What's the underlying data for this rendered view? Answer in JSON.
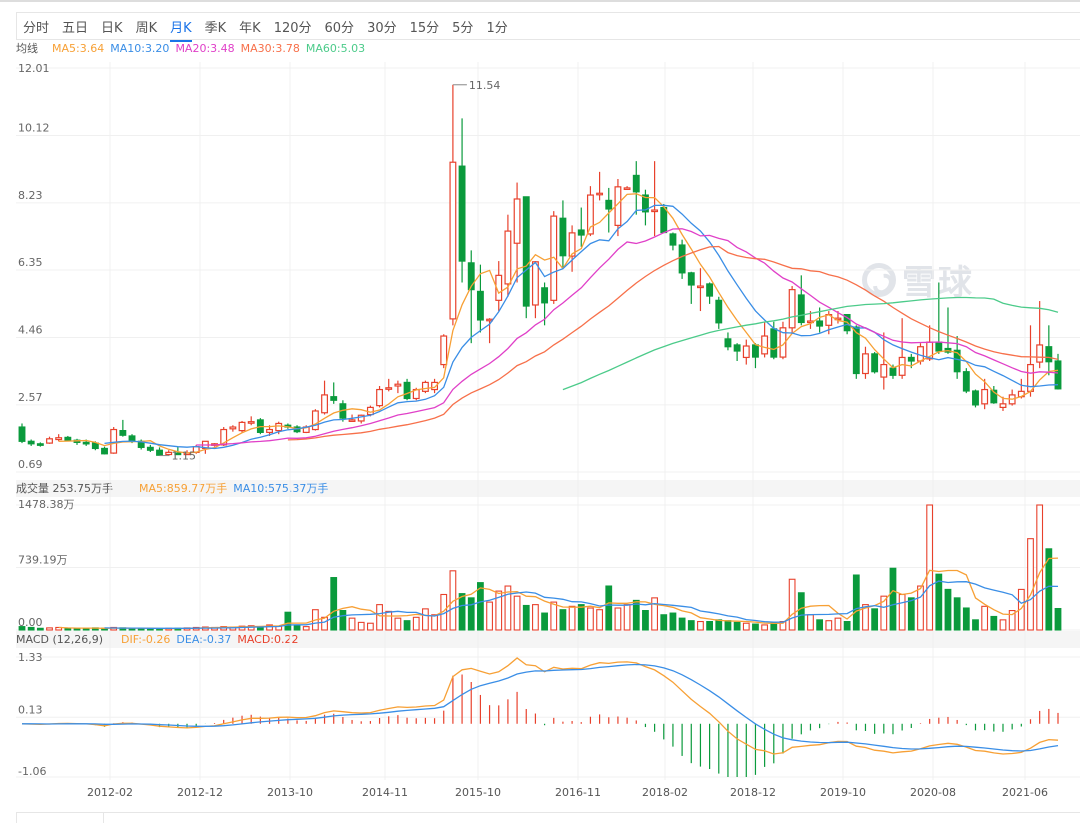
{
  "tabs": [
    "分时",
    "五日",
    "日K",
    "周K",
    "月K",
    "季K",
    "年K",
    "120分",
    "60分",
    "30分",
    "15分",
    "5分",
    "1分"
  ],
  "active_tab": "月K",
  "ma_legend": {
    "label": "均线",
    "items": [
      {
        "text": "MA5:3.64",
        "color": "#f7a035"
      },
      {
        "text": "MA10:3.20",
        "color": "#3a8ee6"
      },
      {
        "text": "MA20:3.48",
        "color": "#e040c8"
      },
      {
        "text": "MA30:3.78",
        "color": "#f7704a"
      },
      {
        "text": "MA60:5.03",
        "color": "#4ccb8a"
      }
    ]
  },
  "volume_legend": {
    "label": "成交量 253.75万手",
    "items": [
      {
        "text": "MA5:859.77万手",
        "color": "#f7a035"
      },
      {
        "text": "MA10:575.37万手",
        "color": "#3a8ee6"
      }
    ]
  },
  "macd_legend": {
    "label": "MACD (12,26,9)",
    "items": [
      {
        "text": "DIF:-0.26",
        "color": "#f7a035"
      },
      {
        "text": "DEA:-0.37",
        "color": "#3a8ee6"
      },
      {
        "text": "MACD:0.22",
        "color": "#e8412c"
      }
    ]
  },
  "watermark": "雪球",
  "colors": {
    "up": "#e8412c",
    "down": "#0a9a3c",
    "grid": "#f0f0f0"
  },
  "chart_data": {
    "type": "candlestick",
    "interval": "monthly",
    "x_labels": [
      "2012-02",
      "2012-12",
      "2013-10",
      "2014-11",
      "2015-10",
      "2016-11",
      "2018-02",
      "2018-12",
      "2019-10",
      "2020-08",
      "2021-06"
    ],
    "price_ticks": [
      "12.01",
      "10.12",
      "8.23",
      "6.35",
      "4.46",
      "2.57",
      "0.69"
    ],
    "price_range": [
      0.69,
      12.01
    ],
    "max_label": "11.54",
    "min_label": "1.15",
    "ma_periods": [
      5,
      10,
      20,
      30,
      60
    ],
    "ohlc": [
      [
        1.95,
        2.05,
        1.5,
        1.55
      ],
      [
        1.55,
        1.6,
        1.42,
        1.48
      ],
      [
        1.48,
        1.52,
        1.4,
        1.45
      ],
      [
        1.5,
        1.68,
        1.48,
        1.62
      ],
      [
        1.6,
        1.75,
        1.55,
        1.65
      ],
      [
        1.66,
        1.7,
        1.55,
        1.58
      ],
      [
        1.58,
        1.62,
        1.45,
        1.52
      ],
      [
        1.52,
        1.6,
        1.42,
        1.5
      ],
      [
        1.5,
        1.55,
        1.3,
        1.35
      ],
      [
        1.35,
        1.4,
        1.18,
        1.2
      ],
      [
        1.22,
        1.95,
        1.2,
        1.88
      ],
      [
        1.85,
        2.15,
        1.68,
        1.72
      ],
      [
        1.7,
        1.75,
        1.5,
        1.55
      ],
      [
        1.55,
        1.6,
        1.32,
        1.38
      ],
      [
        1.38,
        1.45,
        1.25,
        1.3
      ],
      [
        1.3,
        1.38,
        1.15,
        1.16
      ],
      [
        1.18,
        1.3,
        1.16,
        1.24
      ],
      [
        1.22,
        1.4,
        1.18,
        1.2
      ],
      [
        1.2,
        1.3,
        1.17,
        1.22
      ],
      [
        1.24,
        1.45,
        1.2,
        1.4
      ],
      [
        1.35,
        1.5,
        1.2,
        1.55
      ],
      [
        1.45,
        1.5,
        1.4,
        1.48
      ],
      [
        1.45,
        1.95,
        1.42,
        1.88
      ],
      [
        1.9,
        2.0,
        1.82,
        1.95
      ],
      [
        1.85,
        2.12,
        1.8,
        2.08
      ],
      [
        2.1,
        2.25,
        2.0,
        2.1
      ],
      [
        2.15,
        2.2,
        1.75,
        1.8
      ],
      [
        1.8,
        2.0,
        1.7,
        1.88
      ],
      [
        1.85,
        2.1,
        1.75,
        2.05
      ],
      [
        2.0,
        2.05,
        1.9,
        1.95
      ],
      [
        1.95,
        2.0,
        1.78,
        1.82
      ],
      [
        1.8,
        2.0,
        1.78,
        1.95
      ],
      [
        1.88,
        2.45,
        1.85,
        2.4
      ],
      [
        2.35,
        3.25,
        2.3,
        2.85
      ],
      [
        2.8,
        3.2,
        2.6,
        2.7
      ],
      [
        2.6,
        2.7,
        2.1,
        2.2
      ],
      [
        2.15,
        2.3,
        2.1,
        2.15
      ],
      [
        2.12,
        2.3,
        2.05,
        2.28
      ],
      [
        2.3,
        2.55,
        2.25,
        2.5
      ],
      [
        2.55,
        3.1,
        2.5,
        3.0
      ],
      [
        3.05,
        3.3,
        2.95,
        3.05
      ],
      [
        3.1,
        3.25,
        2.9,
        3.15
      ],
      [
        3.2,
        3.3,
        2.7,
        2.75
      ],
      [
        2.75,
        3.05,
        2.7,
        3.0
      ],
      [
        2.95,
        3.25,
        2.9,
        3.2
      ],
      [
        3.0,
        3.3,
        2.9,
        3.2
      ],
      [
        3.7,
        4.55,
        3.6,
        4.5
      ],
      [
        4.98,
        11.54,
        4.8,
        9.37
      ],
      [
        9.26,
        10.6,
        6.0,
        6.6
      ],
      [
        6.55,
        6.9,
        4.3,
        5.8
      ],
      [
        5.75,
        6.5,
        4.6,
        4.95
      ],
      [
        4.97,
        5.0,
        4.3,
        4.97
      ],
      [
        5.5,
        6.6,
        5.2,
        6.2
      ],
      [
        5.96,
        7.9,
        5.6,
        7.44
      ],
      [
        7.1,
        8.8,
        6.0,
        8.34
      ],
      [
        8.4,
        8.4,
        5.0,
        5.34
      ],
      [
        5.37,
        6.6,
        5.0,
        6.58
      ],
      [
        5.85,
        6.0,
        4.8,
        5.43
      ],
      [
        5.5,
        8.0,
        5.4,
        7.86
      ],
      [
        7.8,
        8.3,
        6.4,
        6.75
      ],
      [
        6.74,
        7.6,
        6.3,
        7.39
      ],
      [
        7.47,
        8.1,
        7.0,
        7.33
      ],
      [
        7.36,
        8.7,
        7.3,
        8.45
      ],
      [
        8.5,
        9.1,
        8.3,
        8.5
      ],
      [
        8.3,
        8.65,
        7.4,
        8.06
      ],
      [
        7.6,
        8.9,
        7.3,
        8.68
      ],
      [
        8.65,
        8.7,
        8.6,
        8.65
      ],
      [
        9.0,
        9.4,
        7.9,
        8.54
      ],
      [
        8.45,
        8.6,
        7.6,
        7.98
      ],
      [
        8.03,
        9.4,
        7.3,
        8.03
      ],
      [
        8.1,
        8.2,
        7.4,
        7.4
      ],
      [
        7.36,
        7.4,
        6.9,
        7.05
      ],
      [
        7.05,
        7.2,
        6.1,
        6.27
      ],
      [
        6.27,
        6.3,
        5.4,
        5.93
      ],
      [
        5.9,
        6.4,
        5.2,
        5.9
      ],
      [
        5.96,
        6.0,
        5.4,
        5.62
      ],
      [
        5.5,
        5.6,
        4.7,
        4.87
      ],
      [
        4.42,
        4.6,
        4.1,
        4.2
      ],
      [
        4.25,
        4.3,
        3.8,
        4.08
      ],
      [
        3.9,
        4.4,
        3.7,
        4.22
      ],
      [
        4.25,
        4.3,
        3.6,
        3.91
      ],
      [
        4.0,
        4.9,
        3.9,
        4.5
      ],
      [
        4.7,
        4.9,
        3.85,
        3.91
      ],
      [
        3.91,
        4.9,
        3.85,
        4.73
      ],
      [
        4.73,
        5.9,
        4.6,
        5.8
      ],
      [
        5.65,
        6.2,
        4.8,
        4.88
      ],
      [
        4.92,
        5.2,
        4.7,
        4.92
      ],
      [
        4.92,
        5.3,
        4.6,
        4.78
      ],
      [
        4.8,
        5.2,
        4.55,
        5.1
      ],
      [
        5.0,
        5.2,
        4.85,
        5.0
      ],
      [
        5.1,
        5.1,
        4.55,
        4.65
      ],
      [
        4.75,
        4.8,
        3.3,
        3.45
      ],
      [
        3.45,
        4.2,
        3.3,
        4.0
      ],
      [
        4.0,
        4.05,
        3.45,
        3.5
      ],
      [
        3.35,
        4.6,
        3.0,
        3.7
      ],
      [
        3.6,
        3.7,
        3.3,
        3.4
      ],
      [
        3.4,
        5.0,
        3.3,
        3.9
      ],
      [
        3.9,
        4.0,
        3.6,
        3.8
      ],
      [
        3.8,
        4.3,
        3.7,
        4.2
      ],
      [
        3.86,
        4.8,
        3.8,
        4.33
      ],
      [
        4.33,
        6.0,
        4.0,
        4.08
      ],
      [
        4.15,
        5.3,
        4.0,
        4.05
      ],
      [
        4.1,
        4.5,
        3.3,
        3.5
      ],
      [
        3.5,
        3.6,
        2.9,
        2.96
      ],
      [
        2.96,
        3.0,
        2.5,
        2.57
      ],
      [
        2.6,
        3.3,
        2.45,
        3.0
      ],
      [
        2.98,
        3.1,
        2.6,
        2.63
      ],
      [
        2.5,
        2.8,
        2.4,
        2.6
      ],
      [
        2.6,
        3.0,
        2.55,
        2.85
      ],
      [
        2.8,
        3.3,
        2.75,
        2.95
      ],
      [
        2.95,
        4.8,
        2.8,
        3.7
      ],
      [
        3.77,
        5.48,
        3.6,
        4.25
      ],
      [
        4.2,
        4.8,
        3.4,
        3.78
      ],
      [
        3.8,
        4.0,
        3.0,
        3.02
      ]
    ],
    "volume_unit": "万手",
    "volume_ticks": [
      "1478.38万",
      "739.19万",
      "0.00"
    ],
    "volume_range": [
      0,
      1478.38
    ],
    "volume_ma_periods": [
      5,
      10
    ],
    "volume": [
      40,
      30,
      20,
      25,
      30,
      20,
      15,
      20,
      25,
      20,
      30,
      25,
      15,
      20,
      15,
      15,
      20,
      20,
      25,
      30,
      35,
      30,
      40,
      35,
      45,
      50,
      40,
      60,
      45,
      210,
      55,
      40,
      240,
      150,
      620,
      230,
      140,
      90,
      80,
      300,
      220,
      140,
      110,
      150,
      250,
      180,
      420,
      700,
      430,
      380,
      560,
      330,
      460,
      520,
      400,
      290,
      300,
      200,
      330,
      240,
      280,
      300,
      260,
      240,
      520,
      260,
      300,
      350,
      230,
      380,
      180,
      200,
      140,
      110,
      100,
      100,
      120,
      110,
      90,
      80,
      70,
      60,
      90,
      100,
      600,
      440,
      180,
      120,
      110,
      140,
      100,
      650,
      300,
      250,
      400,
      730,
      420,
      380,
      520,
      1478.38,
      660,
      480,
      380,
      260,
      120,
      280,
      160,
      120,
      230,
      480,
      1080,
      1478.38,
      960,
      253.75
    ],
    "macd_params": [
      12,
      26,
      9
    ],
    "macd_ticks": [
      "1.33",
      "0.13",
      "-1.06"
    ],
    "macd_range": [
      -1.06,
      1.33
    ]
  }
}
